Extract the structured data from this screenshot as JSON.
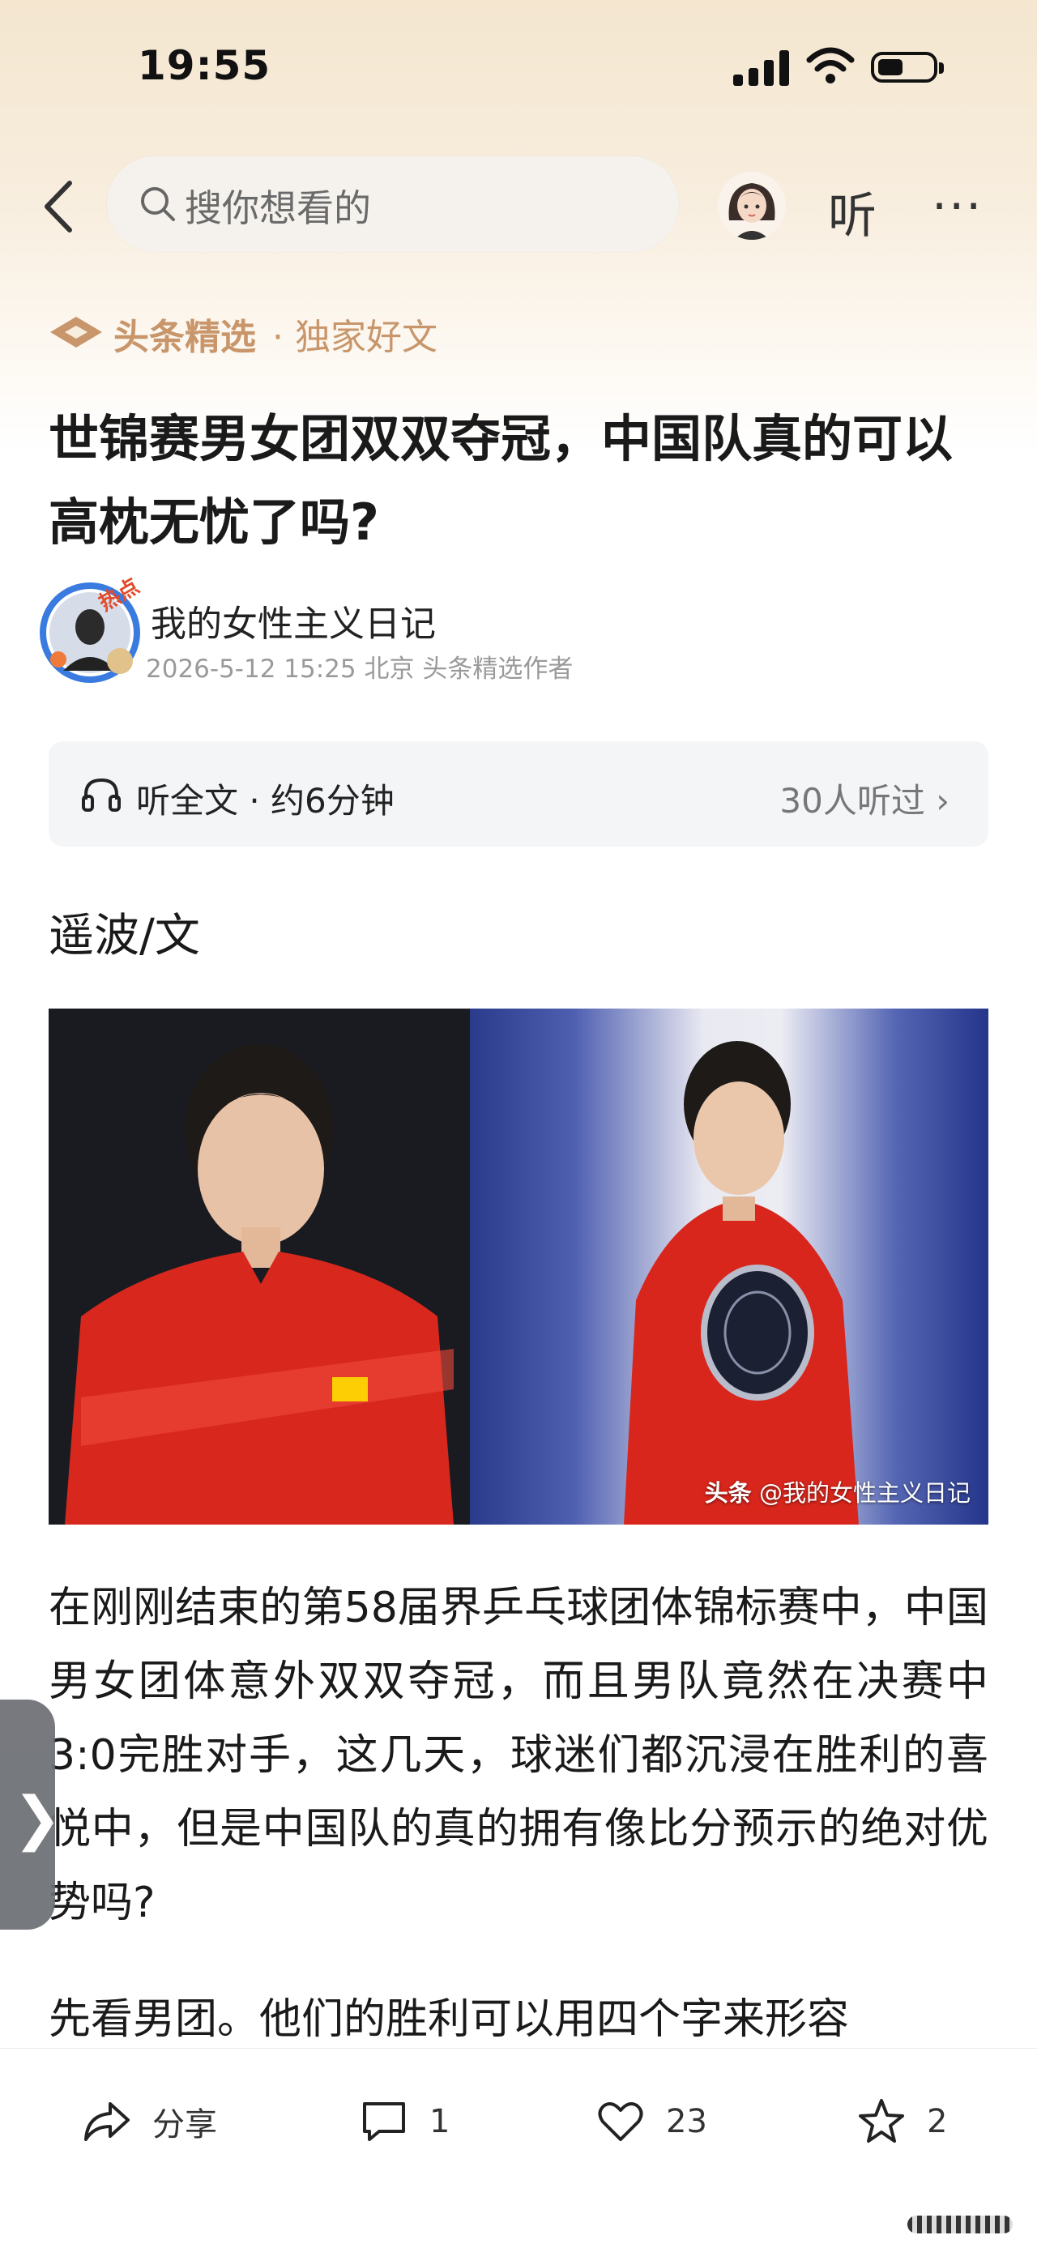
{
  "status_bar": {
    "time": "19:55"
  },
  "header": {
    "search_placeholder": "搜你想看的",
    "listen_label": "听",
    "more_label": "···"
  },
  "source": {
    "brand": "头条精选",
    "sub": "· 独家好文"
  },
  "article": {
    "title": "世锦赛男女团双双夺冠，中国队真的可以高枕无忧了吗?",
    "author": "我的女性主义日记",
    "author_badge": "热点",
    "meta": "2026-5-12  15:25  北京  头条精选作者",
    "listen_label": "听全文 · 约6分钟",
    "listen_count": "30人听过 ›",
    "byline": "遥波/文",
    "image_watermark_brand": "头条",
    "image_watermark_handle": "@我的女性主义日记",
    "paragraph_1": "在刚刚结束的第58届界乒乓球团体锦标赛中，中国男女团体意外双双夺冠，而且男队竟然在决赛中3:0完胜对手，这几天，球迷们都沉浸在胜利的喜悦中，但是中国队的真的拥有像比分预示的绝对优势吗?",
    "paragraph_2": "先看男团。他们的胜利可以用四个字来形容"
  },
  "side_tab": {
    "label": "❯"
  },
  "actions": {
    "share": "分享",
    "comments": "1",
    "likes": "23",
    "favorites": "2"
  },
  "colors": {
    "brand_gold": "#c8966a",
    "accent_red": "#e24a2b"
  }
}
